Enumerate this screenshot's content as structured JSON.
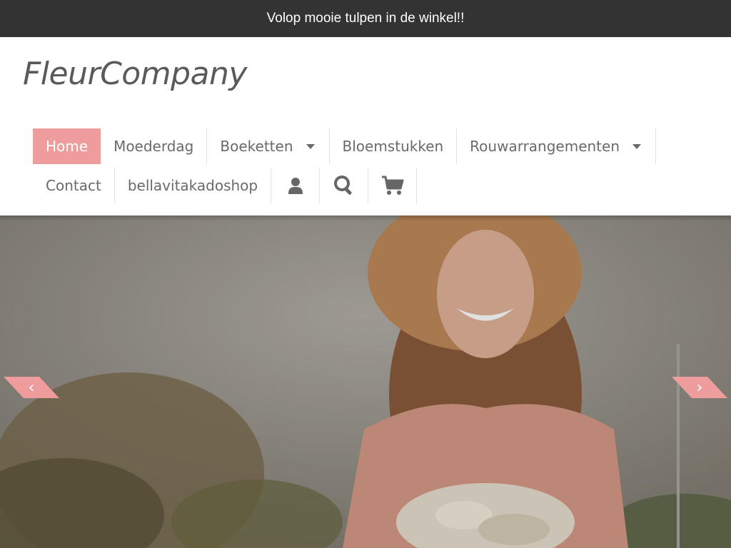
{
  "announcement": "Volop mooie tulpen in de winkel!!",
  "brand": {
    "logo_text": "FleurCompany"
  },
  "nav": {
    "row1": [
      {
        "label": "Home",
        "active": true
      },
      {
        "label": "Moederdag"
      },
      {
        "label": "Boeketten",
        "dropdown": true
      },
      {
        "label": "Bloemstukken"
      },
      {
        "label": "Rouwarrangementen",
        "dropdown": true
      }
    ],
    "row2": [
      {
        "label": "Contact"
      },
      {
        "label": "bellavitakadoshop"
      }
    ],
    "icons": [
      "user-icon",
      "search-icon",
      "cart-icon"
    ]
  },
  "hero": {
    "prev_arrow": "‹",
    "next_arrow": "›",
    "image": "woman-with-straw-hat-and-flower-bouquet"
  },
  "colors": {
    "accent": "#ef9c9c",
    "topbar_bg": "#333333",
    "nav_text": "#6a6a6a"
  }
}
